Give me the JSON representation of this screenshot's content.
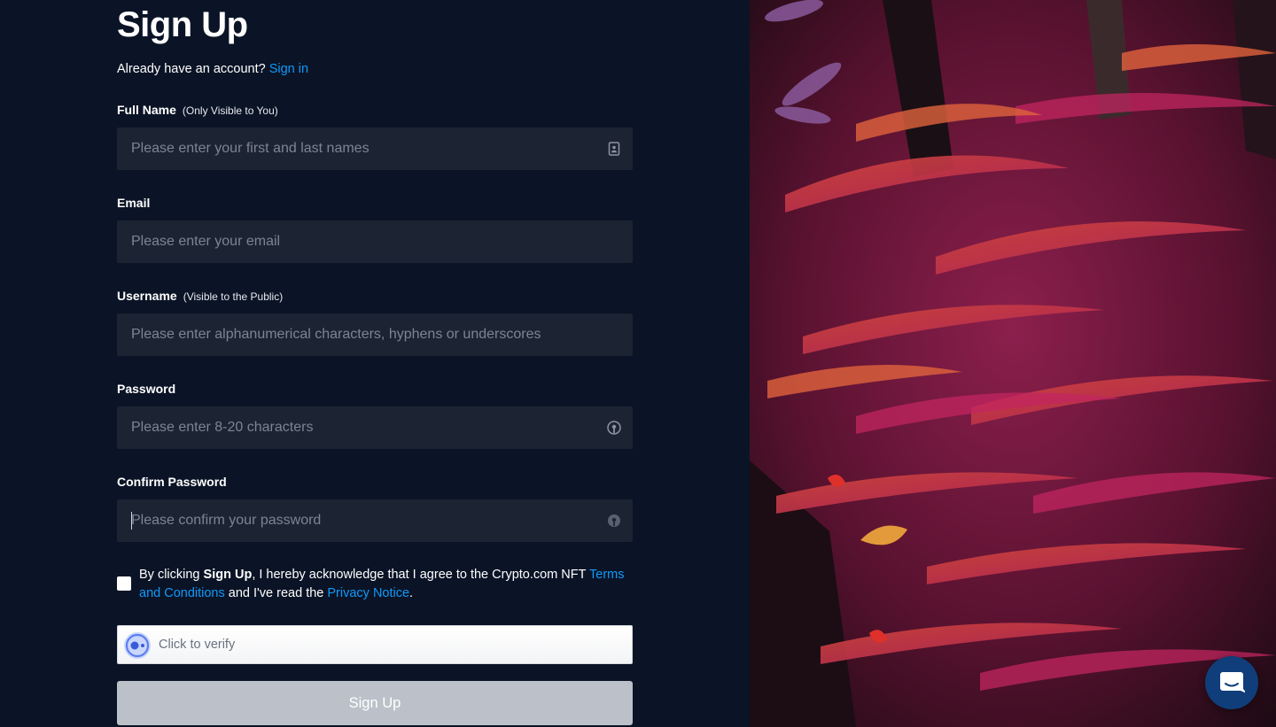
{
  "page": {
    "title": "Sign Up",
    "signin_prompt": "Already have an account?",
    "signin_link": "Sign in"
  },
  "fields": {
    "full_name": {
      "label": "Full Name",
      "note": "(Only Visible to You)",
      "placeholder": "Please enter your first and last names",
      "value": "",
      "icon": "contact-card-icon"
    },
    "email": {
      "label": "Email",
      "placeholder": "Please enter your email",
      "value": ""
    },
    "username": {
      "label": "Username",
      "note": "(Visible to the Public)",
      "placeholder": "Please enter alphanumerical characters, hyphens or underscores",
      "value": ""
    },
    "password": {
      "label": "Password",
      "placeholder": "Please enter 8-20 characters",
      "value": "",
      "icon": "eye-toggle-icon"
    },
    "confirm_password": {
      "label": "Confirm Password",
      "placeholder": "Please confirm your password",
      "value": "",
      "icon": "eye-toggle-icon"
    }
  },
  "terms": {
    "checked": false,
    "text_1": "By clicking ",
    "bold": "Sign Up",
    "text_2": ", I hereby acknowledge that I agree to the Crypto.com NFT ",
    "terms_link": "Terms and Conditions",
    "text_3": " and I've read the ",
    "privacy_link": "Privacy Notice",
    "text_4": "."
  },
  "captcha": {
    "label": "Click to verify",
    "icon": "captcha-icon"
  },
  "submit": {
    "label": "Sign Up",
    "state": "disabled"
  },
  "chat": {
    "icon": "chat-icon"
  },
  "colors": {
    "background": "#0b1426",
    "input_background": "#1c2332",
    "link": "#1199fa",
    "button_disabled": "#bcc1c9",
    "chat_button": "#0f3e7a"
  }
}
